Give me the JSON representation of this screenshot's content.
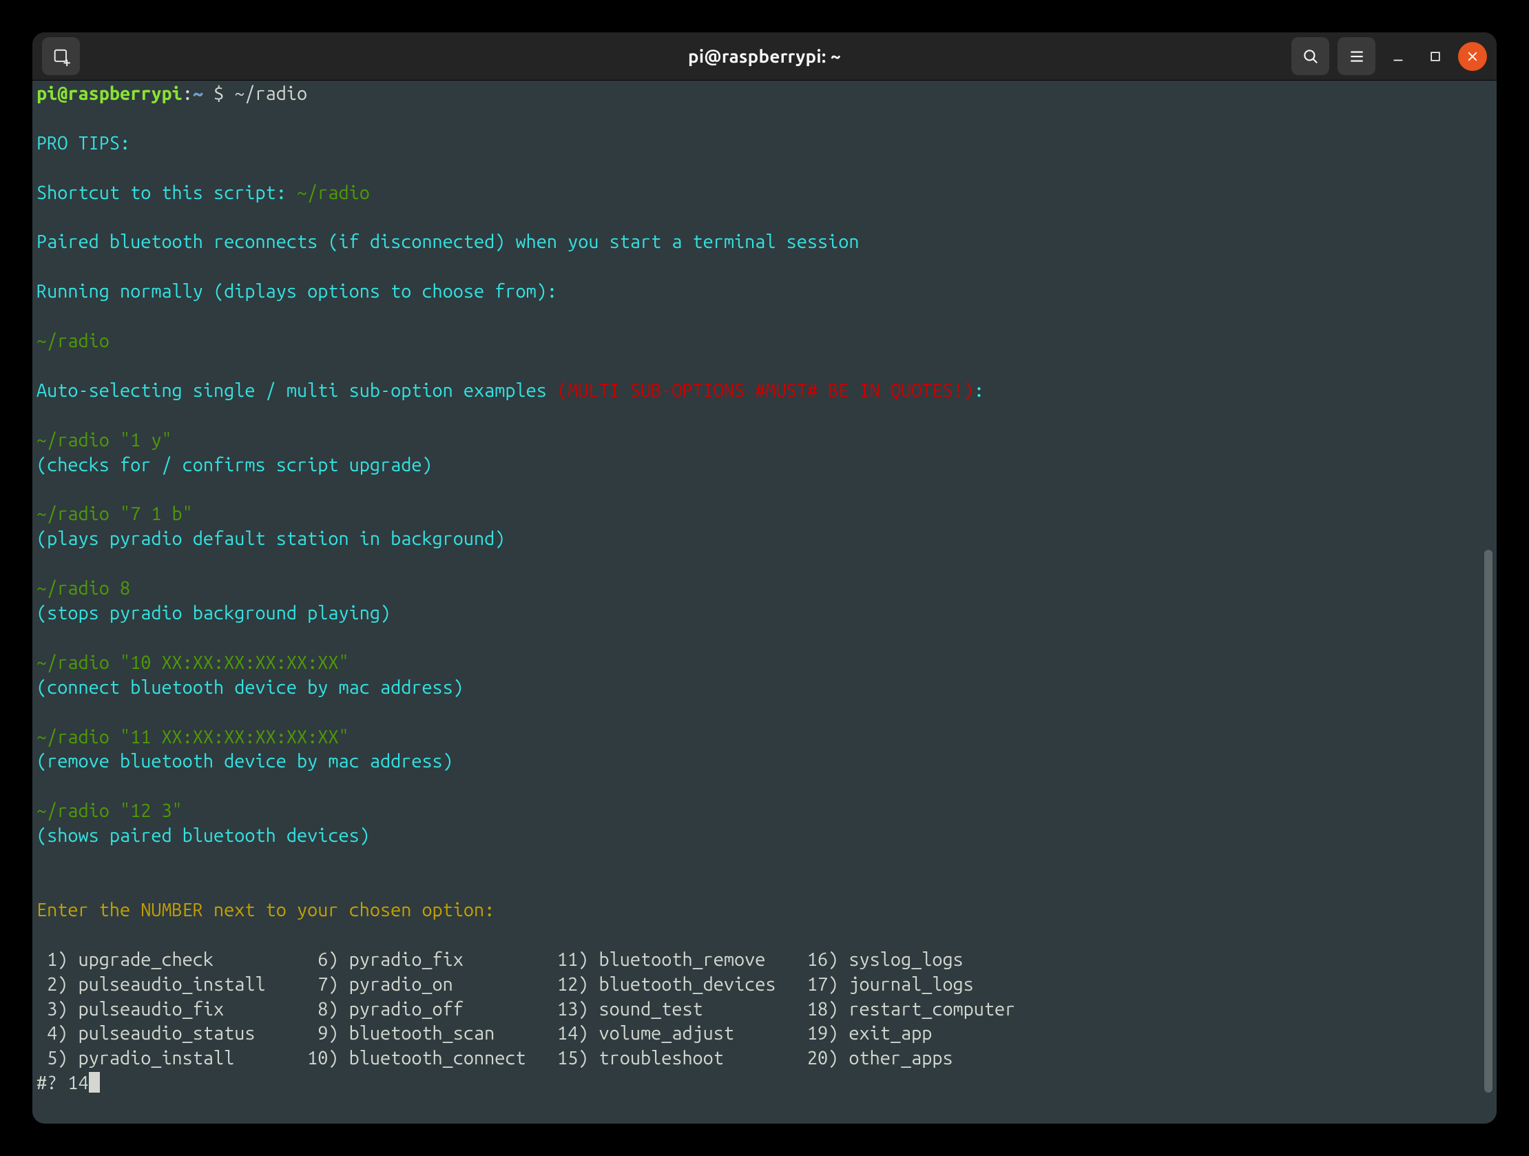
{
  "titlebar": {
    "title": "pi@raspberrypi: ~"
  },
  "prompt": {
    "user": "pi@raspberrypi",
    "sep": ":",
    "path": "~",
    "sigil": "$",
    "command": "~/radio"
  },
  "tips": {
    "header": "PRO TIPS:",
    "shortcut_label": "Shortcut to this script: ",
    "shortcut_cmd": "~/radio",
    "bt_reconnect": "Paired bluetooth reconnects (if disconnected) when you start a terminal session",
    "running_normally": "Running normally (diplays options to choose from):",
    "running_cmd": "~/radio",
    "auto_label": "Auto-selecting single / multi sub-option examples ",
    "auto_warn": "(MULTI SUB-OPTIONS #MUST# BE IN QUOTES!)",
    "auto_colon": ":",
    "ex1_cmd": "~/radio \"1 y\"",
    "ex1_note": "(checks for / confirms script upgrade)",
    "ex2_cmd": "~/radio \"7 1 b\"",
    "ex2_note": "(plays pyradio default station in background)",
    "ex3_cmd": "~/radio 8",
    "ex3_note": "(stops pyradio background playing)",
    "ex4_cmd": "~/radio \"10 XX:XX:XX:XX:XX:XX\"",
    "ex4_note": "(connect bluetooth device by mac address)",
    "ex5_cmd": "~/radio \"11 XX:XX:XX:XX:XX:XX\"",
    "ex5_note": "(remove bluetooth device by mac address)",
    "ex6_cmd": "~/radio \"12 3\"",
    "ex6_note": "(shows paired bluetooth devices)"
  },
  "menu": {
    "prompt": "Enter the NUMBER next to your chosen option:",
    "rows": [
      " 1) upgrade_check          6) pyradio_fix         11) bluetooth_remove    16) syslog_logs",
      " 2) pulseaudio_install     7) pyradio_on          12) bluetooth_devices   17) journal_logs",
      " 3) pulseaudio_fix         8) pyradio_off         13) sound_test          18) restart_computer",
      " 4) pulseaudio_status      9) bluetooth_scan      14) volume_adjust       19) exit_app",
      " 5) pyradio_install       10) bluetooth_connect   15) troubleshoot        20) other_apps"
    ],
    "input_label": "#? ",
    "input_value": "14"
  }
}
